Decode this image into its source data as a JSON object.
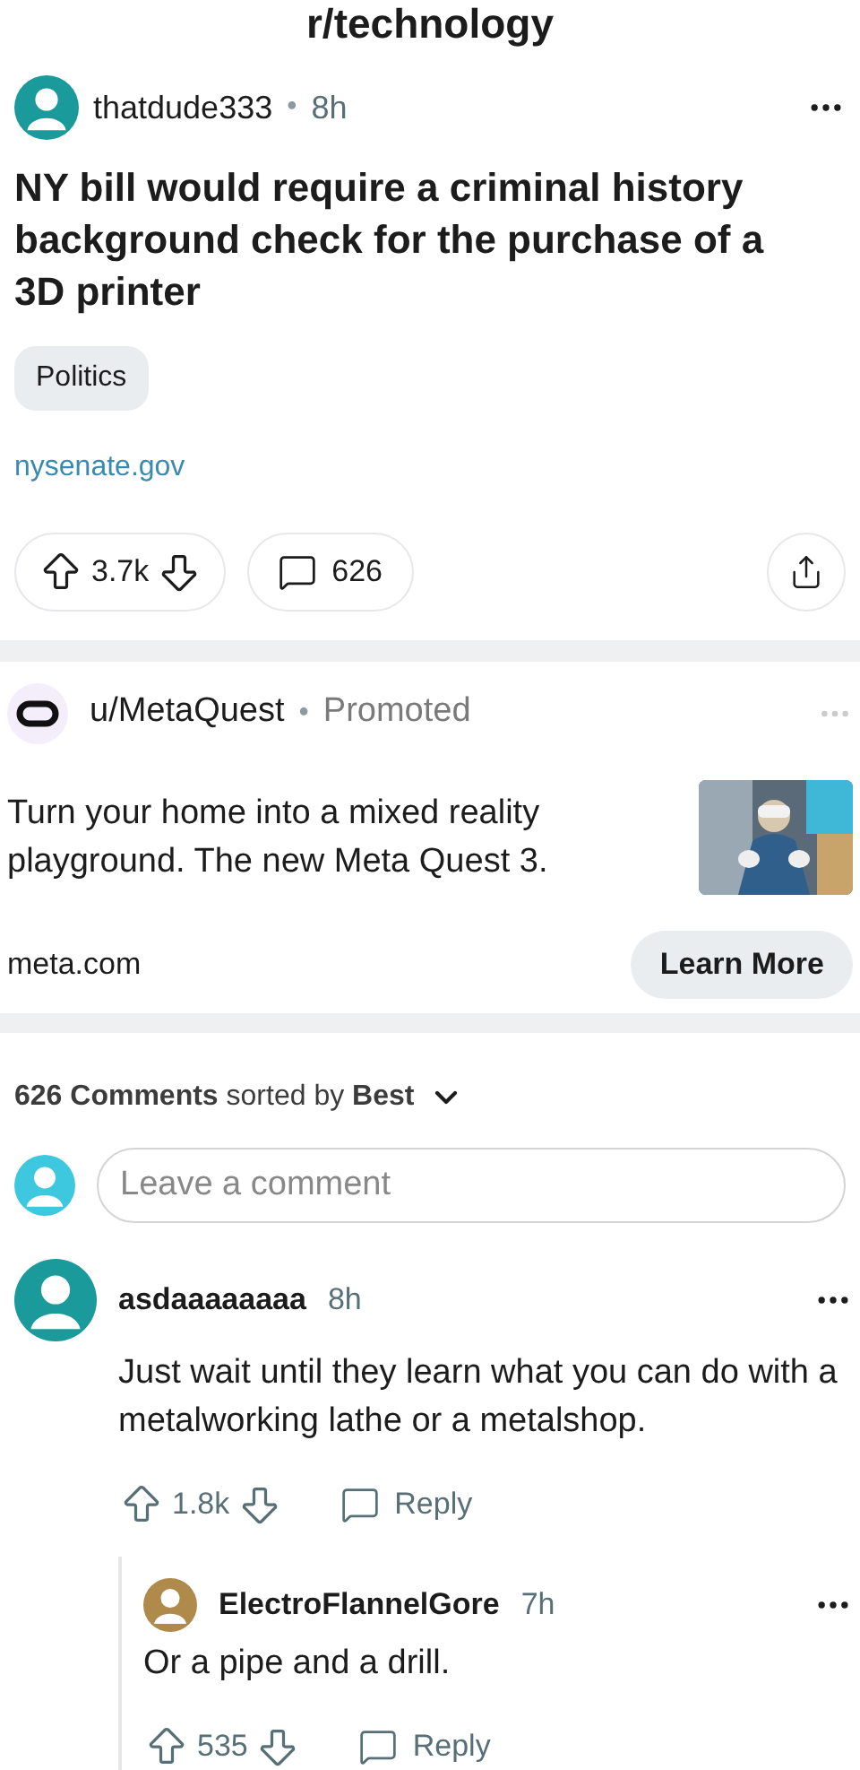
{
  "subreddit": "r/technology",
  "post": {
    "author": "thatdude333",
    "separator": "•",
    "time": "8h",
    "title": "NY bill would require a criminal history background check for the purchase of a 3D printer",
    "flair": "Politics",
    "domain": "nysenate.gov",
    "votes": "3.7k",
    "comments": "626"
  },
  "ad": {
    "advertiser": "u/MetaQuest",
    "separator": "•",
    "label": "Promoted",
    "text": "Turn your home into a mixed reality playground. The new Meta Quest 3.",
    "domain": "meta.com",
    "cta": "Learn More"
  },
  "comments_header": {
    "summary": "**626 Comments** sorted by **Best**"
  },
  "comment_field": {
    "placeholder": "Leave a comment"
  },
  "comments": [
    {
      "author": "asdaaaaaaaa",
      "time": "8h",
      "body": "Just wait until they learn what you can do with a metalworking lathe or a metalshop.",
      "votes": "1.8k",
      "reply": "Reply",
      "children": [
        {
          "author": "ElectroFlannelGore",
          "time": "7h",
          "body": "Or a pipe and a drill.",
          "votes": "535",
          "reply": "Reply"
        }
      ]
    }
  ]
}
